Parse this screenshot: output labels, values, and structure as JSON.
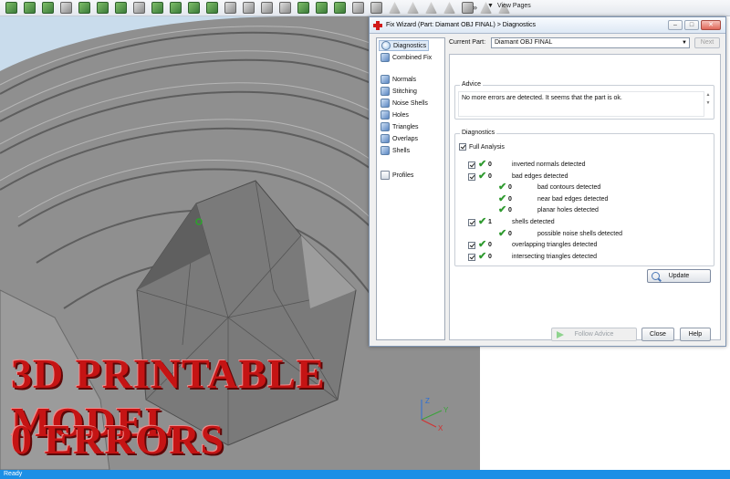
{
  "toolbar": {
    "icon_count": 28,
    "overflow_label": "»",
    "view_pages_label": "View Pages"
  },
  "caption": {
    "line1": "3D PRINTABLE MODEL",
    "line2": "0 ERRORS"
  },
  "status": {
    "text": "Ready"
  },
  "dialog": {
    "title": "Fix Wizard (Part: Diamant OBJ FINAL) > Diagnostics",
    "current_part_label": "Current Part:",
    "current_part_value": "Diamant OBJ FINAL",
    "next_label": "Next",
    "nav": [
      {
        "label": "Diagnostics",
        "icon": "magnifier-icon",
        "active": true
      },
      {
        "label": "Combined Fix",
        "icon": "combined-fix-icon"
      },
      {
        "label": "Normals",
        "icon": "cube-icon"
      },
      {
        "label": "Stitching",
        "icon": "cube-icon"
      },
      {
        "label": "Noise Shells",
        "icon": "cube-icon"
      },
      {
        "label": "Holes",
        "icon": "cube-icon"
      },
      {
        "label": "Triangles",
        "icon": "cube-icon"
      },
      {
        "label": "Overlaps",
        "icon": "cube-icon"
      },
      {
        "label": "Shells",
        "icon": "cube-icon"
      },
      {
        "label": "Profiles",
        "icon": "document-icon"
      }
    ],
    "advice_title": "Advice",
    "advice_text": "No more errors are detected. It seems that the part is ok.",
    "diagnostics_title": "Diagnostics",
    "full_analysis_label": "Full Analysis",
    "rows": [
      {
        "count": "0",
        "label": "inverted normals detected",
        "indent": 0
      },
      {
        "count": "0",
        "label": "bad edges detected",
        "indent": 0
      },
      {
        "count": "0",
        "label": "bad contours detected",
        "indent": 1
      },
      {
        "count": "0",
        "label": "near bad edges detected",
        "indent": 1
      },
      {
        "count": "0",
        "label": "planar holes detected",
        "indent": 1
      },
      {
        "count": "1",
        "label": "shells detected",
        "indent": 0
      },
      {
        "count": "0",
        "label": "possible noise shells detected",
        "indent": 1
      },
      {
        "count": "0",
        "label": "overlapping triangles detected",
        "indent": 0
      },
      {
        "count": "0",
        "label": "intersecting triangles detected",
        "indent": 0
      }
    ],
    "update_label": "Update",
    "follow_advice_label": "Follow Advice",
    "close_label": "Close",
    "help_label": "Help"
  },
  "axes": {
    "x": "X",
    "y": "Y",
    "z": "Z"
  },
  "colors": {
    "viewport_bg": "#c9dcec",
    "model_grey": "#8c8c8c",
    "caption_red": "#c51414",
    "check_green": "#2f9a2f",
    "statusbar_blue": "#1b8fe6"
  }
}
